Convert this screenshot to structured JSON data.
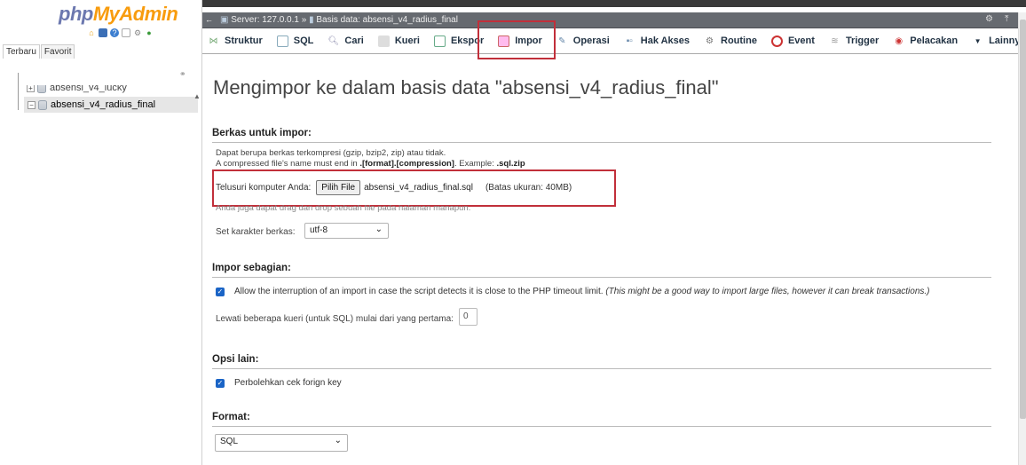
{
  "logo": {
    "part1": "php",
    "part2": "MyAdmin"
  },
  "left_tabs": [
    "Terbaru",
    "Favorit"
  ],
  "tree": [
    {
      "label": "absensi_v4_lucky"
    },
    {
      "label": "absensi_v4_radius_final"
    }
  ],
  "breadcrumb": {
    "server": "Server: 127.0.0.1 »",
    "db": "Basis data: absensi_v4_radius_final"
  },
  "menu": [
    {
      "label": "Struktur",
      "icon": "structure-icon"
    },
    {
      "label": "SQL",
      "icon": "sql-icon"
    },
    {
      "label": "Cari",
      "icon": "search-icon"
    },
    {
      "label": "Kueri",
      "icon": "query-icon"
    },
    {
      "label": "Ekspor",
      "icon": "export-icon"
    },
    {
      "label": "Impor",
      "icon": "import-icon"
    },
    {
      "label": "Operasi",
      "icon": "wrench-icon"
    },
    {
      "label": "Hak Akses",
      "icon": "privileges-icon"
    },
    {
      "label": "Routine",
      "icon": "routine-icon"
    },
    {
      "label": "Event",
      "icon": "clock-icon"
    },
    {
      "label": "Trigger",
      "icon": "trigger-icon"
    },
    {
      "label": "Pelacakan",
      "icon": "eye-icon"
    },
    {
      "label": "Lainnya",
      "icon": "chevron-down-icon"
    }
  ],
  "page_title": "Mengimpor ke dalam basis data \"absensi_v4_radius_final\"",
  "file_section": {
    "heading": "Berkas untuk impor:",
    "line1": "Dapat berupa berkas terkompresi (gzip, bzip2, zip) atau tidak.",
    "line2_prefix": "A compressed file's name must end in ",
    "line2_bold": ".[format].[compression]",
    "line2_mid": ". Example: ",
    "line2_example": ".sql.zip",
    "browse_label": "Telusuri komputer Anda:",
    "choose_button": "Pilih File",
    "file_name": "absensi_v4_radius_final.sql",
    "max_size": "(Batas ukuran: 40MB)",
    "drag_hint": "Anda juga dapat drag dan drop sebuah file pada halaman manapun.",
    "charset_label": "Set karakter berkas:",
    "charset_value": "utf-8"
  },
  "partial_section": {
    "heading": "Impor sebagian:",
    "allow_interrupt": "Allow the interruption of an import in case the script detects it is close to the PHP timeout limit.",
    "allow_interrupt_note": "(This might be a good way to import large files, however it can break transactions.)",
    "skip_label": "Lewati beberapa kueri (untuk SQL) mulai dari yang pertama:",
    "skip_value": "0"
  },
  "other_section": {
    "heading": "Opsi lain:",
    "fk_label": "Perbolehkan cek forign key"
  },
  "format_section": {
    "heading": "Format:",
    "format_value": "SQL"
  },
  "colors": {
    "highlight": "#c12f3a",
    "checkbox": "#1a64c6",
    "breadcrumb_bg": "#666a70"
  }
}
